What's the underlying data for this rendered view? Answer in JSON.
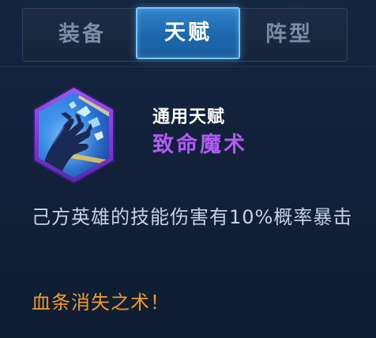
{
  "tabs": [
    {
      "label": "装备",
      "active": false
    },
    {
      "label": "天赋",
      "active": true
    },
    {
      "label": "阵型",
      "active": false
    }
  ],
  "talent": {
    "type_label": "通用天赋",
    "name": "致命魔术",
    "description": "己方英雄的技能伤害有10%概率暴击",
    "tagline": "血条消失之术！"
  },
  "icons": {
    "talent_badge": "clawed-hand-magic-icon"
  },
  "colors": {
    "tab_active_bg": "#1d67ad",
    "tab_active_border": "#7cc3f6",
    "talent_name": "#b15bf0",
    "tagline": "#ef9a2a",
    "badge_frame": "#7a3bd2",
    "badge_bg": "#1f5fc9"
  }
}
